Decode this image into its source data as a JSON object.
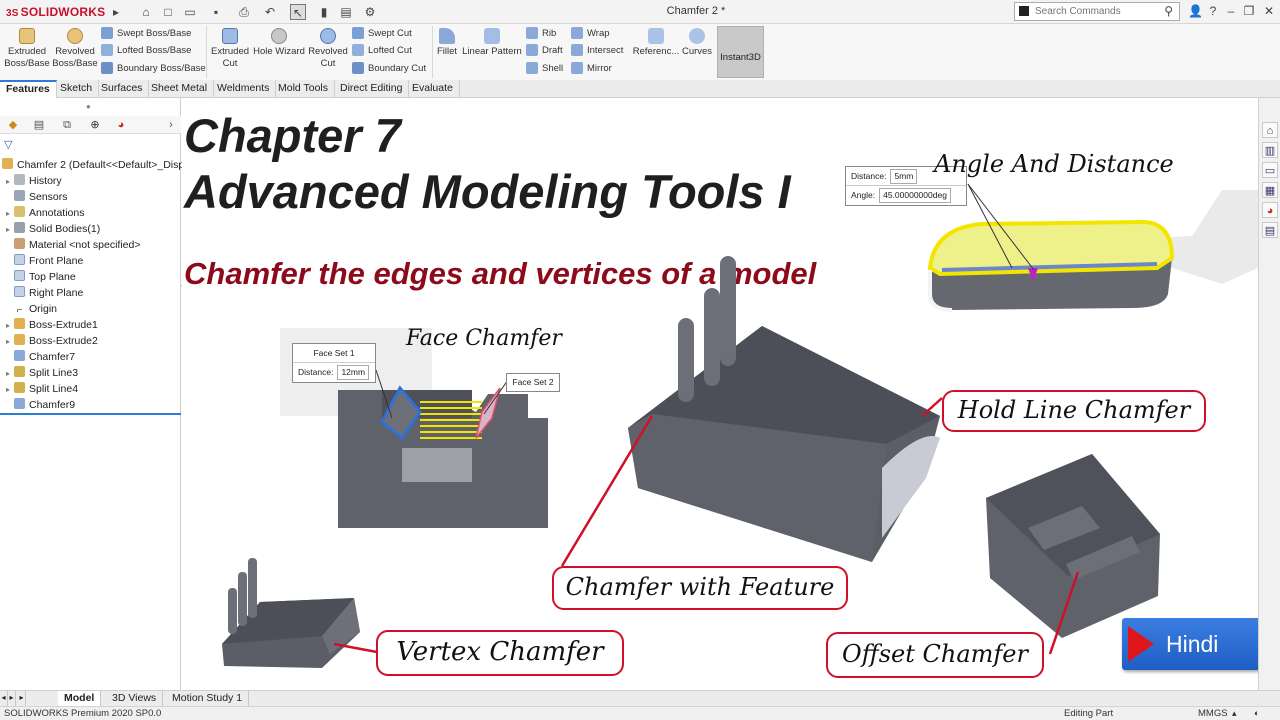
{
  "app": {
    "logo": "SOLIDWORKS",
    "doc_title": "Chamfer 2 *"
  },
  "search": {
    "placeholder": "Search Commands"
  },
  "ribbon": {
    "extruded_boss": "Extruded Boss/Base",
    "revolved_boss": "Revolved Boss/Base",
    "swept_boss": "Swept Boss/Base",
    "lofted_boss": "Lofted Boss/Base",
    "boundary_boss": "Boundary Boss/Base",
    "extruded_cut": "Extruded Cut",
    "hole_wizard": "Hole Wizard",
    "revolved_cut": "Revolved Cut",
    "swept_cut": "Swept Cut",
    "lofted_cut": "Lofted Cut",
    "boundary_cut": "Boundary Cut",
    "fillet": "Fillet",
    "linear_pattern": "Linear Pattern",
    "rib": "Rib",
    "draft": "Draft",
    "shell": "Shell",
    "wrap": "Wrap",
    "intersect": "Intersect",
    "mirror": "Mirror",
    "reference": "Referenc...",
    "curves": "Curves",
    "instant3d": "Instant3D"
  },
  "tabs": [
    "Features",
    "Sketch",
    "Surfaces",
    "Sheet Metal",
    "Weldments",
    "Mold Tools",
    "Direct Editing",
    "Evaluate"
  ],
  "tree": {
    "root": "Chamfer 2  (Default<<Default>_Disp",
    "items": [
      "History",
      "Sensors",
      "Annotations",
      "Solid Bodies(1)",
      "Material <not specified>",
      "Front Plane",
      "Top Plane",
      "Right Plane",
      "Origin",
      "Boss-Extrude1",
      "Boss-Extrude2",
      "Chamfer7",
      "Split Line3",
      "Split Line4",
      "Chamfer9"
    ]
  },
  "graphics": {
    "chapter": "Chapter 7",
    "title": "Advanced Modeling Tools I",
    "subtitle": "Chamfer the edges and vertices of a model",
    "angle_distance": "Angle And Distance",
    "face_chamfer": "Face Chamfer",
    "hold_line": "Hold Line Chamfer",
    "chamfer_feature": "Chamfer with Feature",
    "vertex": "Vertex Chamfer",
    "offset": "Offset Chamfer",
    "hindi": "Hindi",
    "pm_angle": {
      "distance_label": "Distance:",
      "distance_value": "5mm",
      "angle_label": "Angle:",
      "angle_value": "45.00000000deg"
    },
    "pm_face": {
      "set1": "Face Set 1",
      "distance_label": "Distance:",
      "distance_value": "12mm",
      "set2": "Face Set 2"
    }
  },
  "bottom_tabs": [
    "Model",
    "3D Views",
    "Motion Study 1"
  ],
  "status": {
    "left": "SOLIDWORKS Premium 2020 SP0.0",
    "mode": "Editing Part",
    "units": "MMGS"
  },
  "colors": {
    "accent_blue": "#2b7bd8",
    "callout_red": "#d01028",
    "subtitle_red": "#8c0a1a",
    "model_gray": "#5c5f66",
    "highlight_yellow": "#f2e600"
  }
}
